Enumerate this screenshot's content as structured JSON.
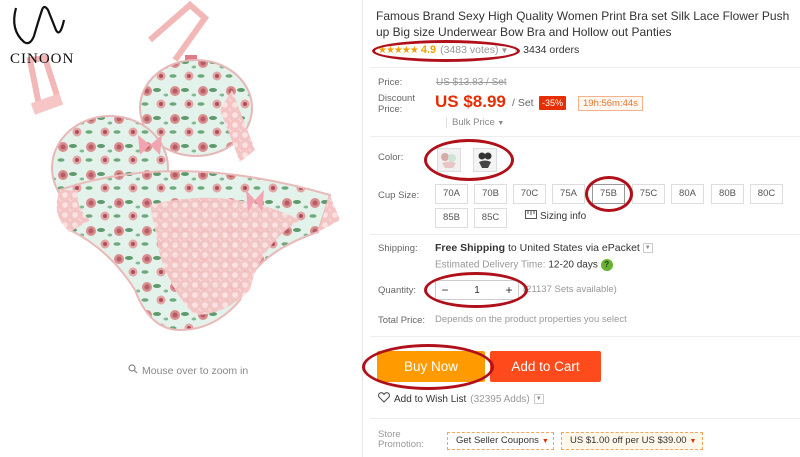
{
  "brand": {
    "name": "CINOON"
  },
  "gallery": {
    "zoom_hint": "Mouse over to zoom in"
  },
  "product": {
    "title": "Famous Brand Sexy High Quality Women Print Bra set Silk Lace Flower Push up Big size Underwear Bow Bra and Hollow out Panties",
    "stars": "★★★★★",
    "rating": "4.9",
    "votes": "(3483 votes)",
    "orders": "3434 orders"
  },
  "price": {
    "price_label": "Price:",
    "old_price": "US $13.83 / Set",
    "discount_label": "Discount Price:",
    "current": "US $8.99",
    "unit": "/ Set",
    "discount": "-35%",
    "timer": "19h:56m:44s",
    "bulk": "Bulk Price"
  },
  "options": {
    "color_label": "Color:",
    "cup_label": "Cup Size:",
    "sizes": [
      "70A",
      "70B",
      "70C",
      "75A",
      "75B",
      "75C",
      "80A",
      "80B",
      "80C",
      "85B",
      "85C"
    ],
    "selected_size": "75B",
    "sizing_info": "Sizing info"
  },
  "shipping": {
    "label": "Shipping:",
    "free": "Free Shipping",
    "to": "to United States via ePacket",
    "est_label": "Estimated Delivery Time:",
    "est_value": "12-20 days"
  },
  "quantity": {
    "label": "Quantity:",
    "minus": "−",
    "value": "1",
    "plus": "+",
    "available": "(21137 Sets available)"
  },
  "total": {
    "label": "Total Price:",
    "value": "Depends on the product properties you select"
  },
  "actions": {
    "buy_now": "Buy Now",
    "add_to_cart": "Add to Cart",
    "wish": "Add to Wish List",
    "wish_count": "(32395 Adds)"
  },
  "promotion": {
    "label": "Store Promotion:",
    "coupon": "Get Seller Coupons",
    "offer": "US $1.00 off per US $39.00"
  },
  "colors": {
    "price_red": "#e62e04",
    "buy_orange": "#ff9a00",
    "cart_red": "#ff4a1b",
    "star_gold": "#f2a100",
    "annotation_red": "#b0101a"
  }
}
